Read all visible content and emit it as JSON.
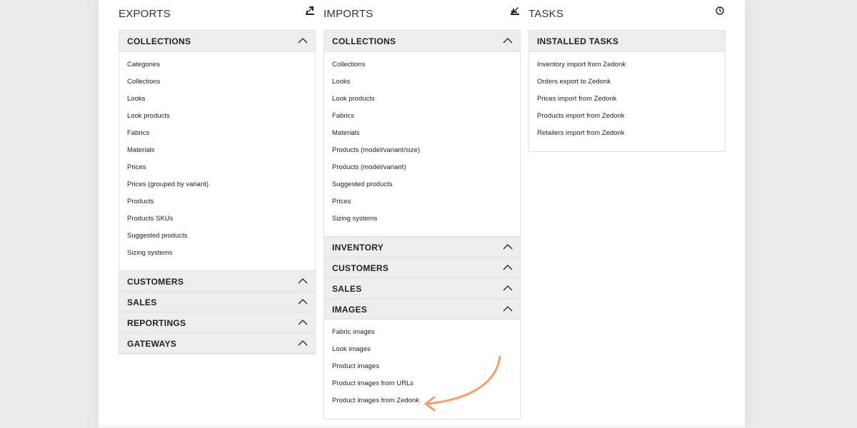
{
  "accent_color": "#f3a06b",
  "exports": {
    "title": "EXPORTS",
    "icon": "export-icon",
    "sections": [
      {
        "label": "COLLECTIONS",
        "expanded": true,
        "items": [
          "Categories",
          "Collections",
          "Looks",
          "Look products",
          "Fabrics",
          "Materials",
          "Prices",
          "Prices (grouped by variant)",
          "Products",
          "Products SKUs",
          "Suggested products",
          "Sizing systems"
        ]
      },
      {
        "label": "CUSTOMERS",
        "expanded": false
      },
      {
        "label": "SALES",
        "expanded": false
      },
      {
        "label": "REPORTINGS",
        "expanded": false
      },
      {
        "label": "GATEWAYS",
        "expanded": false
      }
    ]
  },
  "imports": {
    "title": "IMPORTS",
    "icon": "import-icon",
    "sections": [
      {
        "label": "COLLECTIONS",
        "expanded": true,
        "items": [
          "Collections",
          "Looks",
          "Look products",
          "Fabrics",
          "Materials",
          "Products (model/variant/size)",
          "Products (model/variant)",
          "Suggested products",
          "Prices",
          "Sizing systems"
        ]
      },
      {
        "label": "INVENTORY",
        "expanded": false
      },
      {
        "label": "CUSTOMERS",
        "expanded": false
      },
      {
        "label": "SALES",
        "expanded": false
      },
      {
        "label": "IMAGES",
        "expanded": true,
        "items": [
          "Fabric images",
          "Look images",
          "Product images",
          "Product images from URLs",
          "Product images from Zedonk"
        ]
      }
    ]
  },
  "tasks": {
    "title": "TASKS",
    "icon": "clock-icon",
    "sections": [
      {
        "label": "INSTALLED TASKS",
        "items": [
          "Inventory import from Zedonk",
          "Orders export to Zedonk",
          "Prices import from Zedonk",
          "Products import from Zedonk",
          "Retailers import from Zedonk"
        ]
      }
    ]
  }
}
